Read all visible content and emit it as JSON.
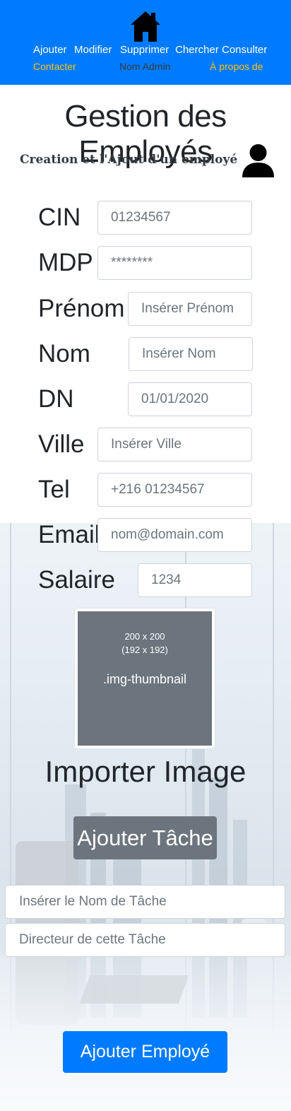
{
  "nav": {
    "links": [
      "Ajouter",
      "Modifier",
      "Supprimer",
      "Chercher",
      "Consulter"
    ],
    "contact": "Contacter",
    "admin": "Nom Admin",
    "about": "À propos de"
  },
  "header": {
    "title": "Gestion des Employés",
    "subtitle": "Creation et l'Ajout d'un employé"
  },
  "form": {
    "cin": {
      "label": "CIN",
      "placeholder": "01234567"
    },
    "mdp": {
      "label": "MDP",
      "placeholder": "********"
    },
    "prenom": {
      "label": "Prénom",
      "placeholder": "Insérer Prénom"
    },
    "nom": {
      "label": "Nom",
      "placeholder": "Insérer Nom"
    },
    "dn": {
      "label": "DN",
      "placeholder": "01/01/2020"
    },
    "ville": {
      "label": "Ville",
      "placeholder": "Insérer Ville"
    },
    "tel": {
      "label": "Tel",
      "placeholder": "+216 01234567"
    },
    "email": {
      "label": "Email",
      "placeholder": "nom@domain.com"
    },
    "salaire": {
      "label": "Salaire",
      "placeholder": "1234"
    }
  },
  "thumbnail": {
    "size_line1": "200 x 200",
    "size_line2": "(192 x 192)",
    "name": ".img-thumbnail"
  },
  "import_label": "Importer Image",
  "task": {
    "button": "Ajouter Tâche",
    "name_placeholder": "Insérer le Nom de Tâche",
    "director_placeholder": "Directeur de cette Tâche"
  },
  "submit_label": "Ajouter Employé",
  "colors": {
    "primary": "#007bff",
    "secondary": "#6c757d",
    "warning": "#ffc107"
  }
}
